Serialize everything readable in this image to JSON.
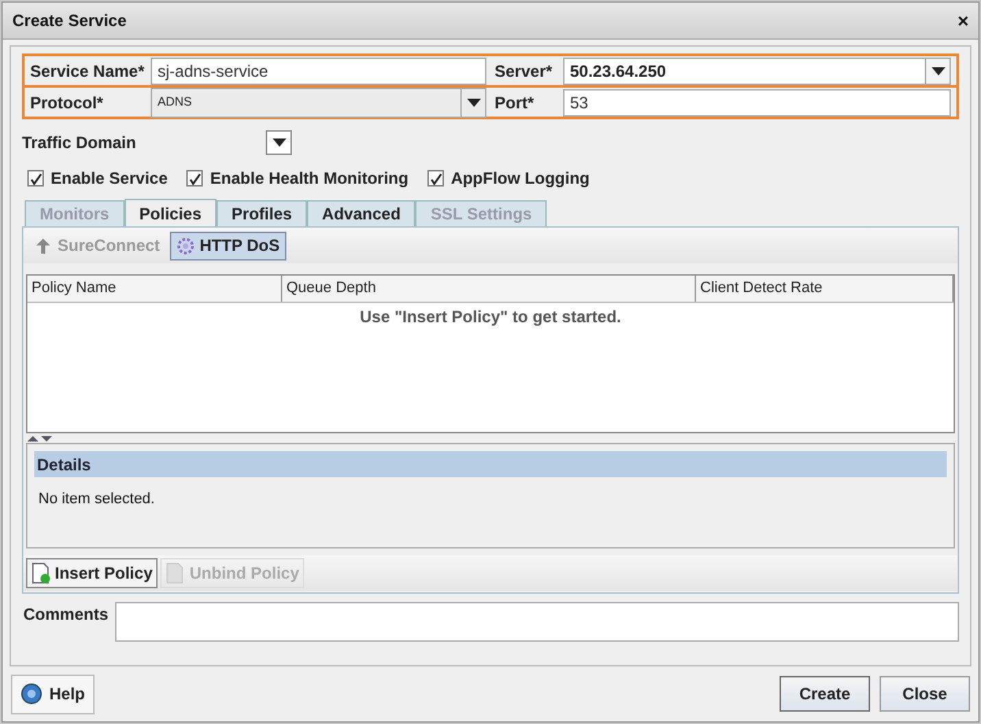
{
  "window": {
    "title": "Create Service",
    "close": "×"
  },
  "field_rows": [
    {
      "highlighted": true,
      "fields": [
        {
          "kind": "text",
          "label": "Service Name*",
          "value": "sj-adns-service"
        },
        {
          "kind": "combo",
          "label": "Server*",
          "value": "50.23.64.250"
        }
      ]
    },
    {
      "highlighted": true,
      "fields": [
        {
          "kind": "select",
          "label": "Protocol*",
          "value": "ADNS"
        },
        {
          "kind": "text",
          "label": "Port*",
          "value": "53"
        }
      ]
    }
  ],
  "traffic_domain": {
    "label": "Traffic Domain"
  },
  "checkboxes": [
    {
      "label": "Enable Service",
      "checked": true
    },
    {
      "label": "Enable Health Monitoring",
      "checked": true
    },
    {
      "label": "AppFlow Logging",
      "checked": true
    }
  ],
  "tabs": [
    {
      "label": "Monitors",
      "selected": false,
      "disabled": true
    },
    {
      "label": "Policies",
      "selected": true,
      "disabled": false
    },
    {
      "label": "Profiles",
      "selected": false,
      "disabled": false
    },
    {
      "label": "Advanced",
      "selected": false,
      "disabled": false
    },
    {
      "label": "SSL Settings",
      "selected": false,
      "disabled": true
    }
  ],
  "policy_types": [
    {
      "label": "SureConnect",
      "selected": false,
      "disabled": true
    },
    {
      "label": "HTTP DoS",
      "selected": true,
      "disabled": false
    }
  ],
  "table": {
    "columns": [
      "Policy Name",
      "Queue Depth",
      "Client Detect Rate"
    ],
    "empty_message": "Use \"Insert Policy\" to get started."
  },
  "details": {
    "title": "Details",
    "message": "No item selected."
  },
  "policy_actions": [
    {
      "label": "Insert Policy",
      "disabled": false
    },
    {
      "label": "Unbind Policy",
      "disabled": true
    }
  ],
  "comments": {
    "label": "Comments"
  },
  "footer": {
    "help": "Help",
    "buttons": [
      "Create",
      "Close"
    ]
  }
}
